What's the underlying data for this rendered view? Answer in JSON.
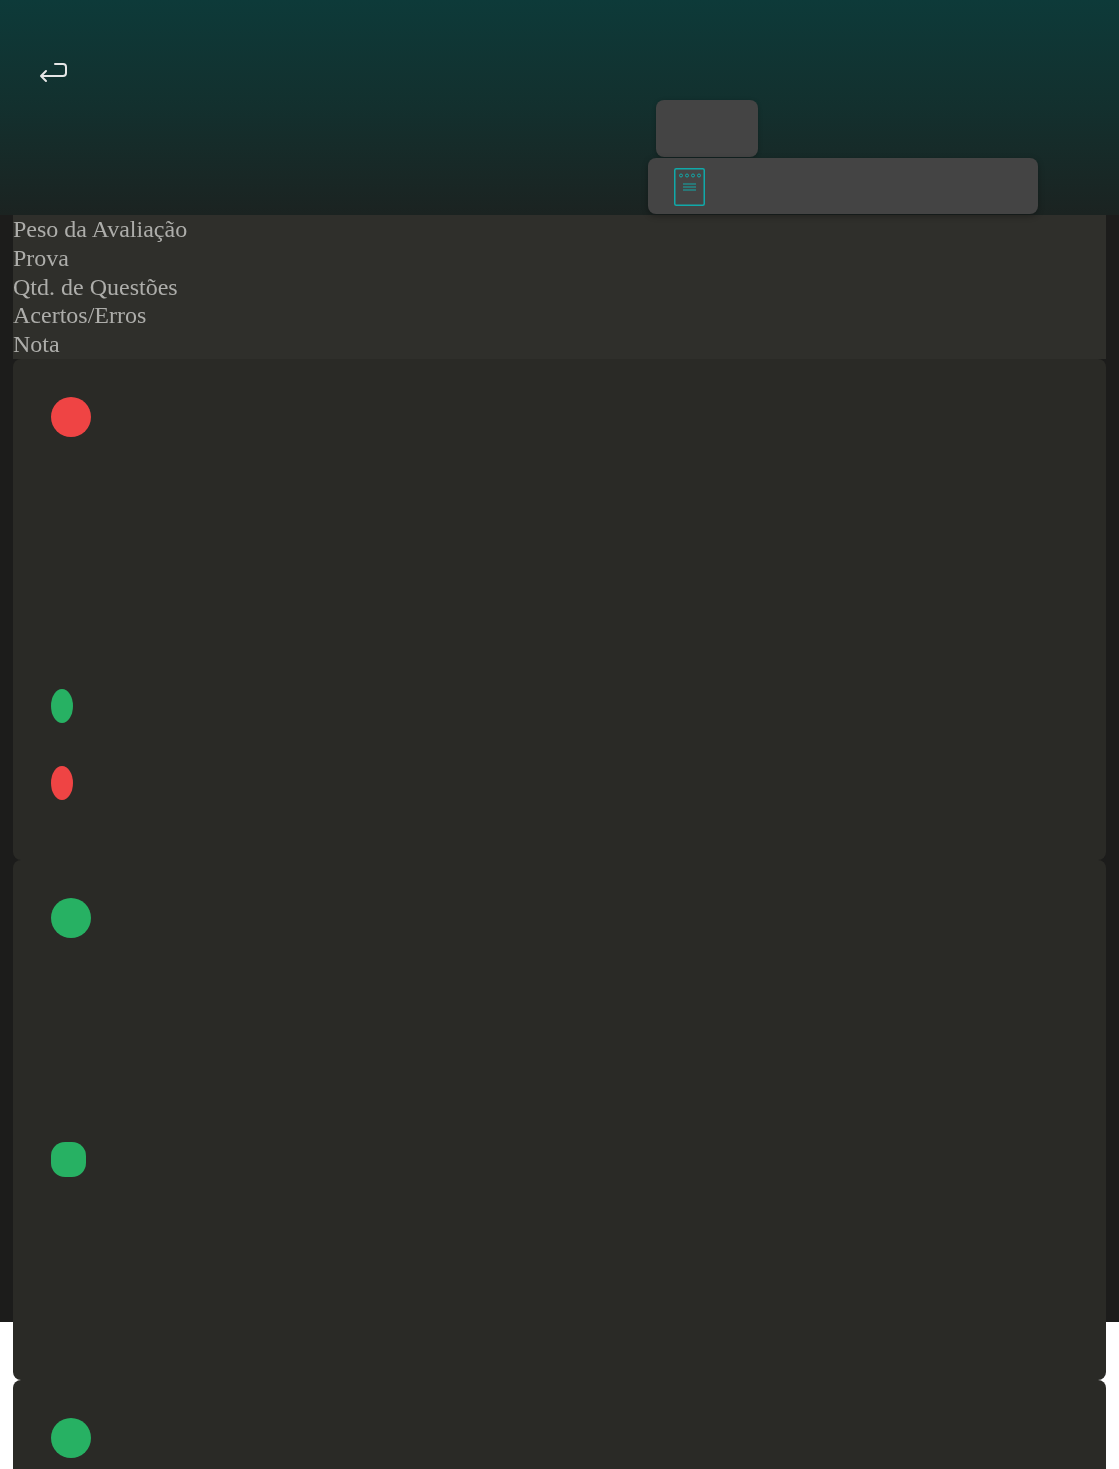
{
  "table": {
    "columns": [
      "Peso da Avaliação",
      "Prova",
      "Qtd. de Questões",
      "Acertos/Erros",
      "Nota"
    ]
  },
  "records": [
    {
      "markers": [
        {
          "kind": "dot",
          "color": "#ef4444"
        },
        {
          "kind": "pill",
          "color": "#27b163"
        },
        {
          "kind": "pill",
          "color": "#ef4444"
        }
      ]
    },
    {
      "markers": [
        {
          "kind": "dot",
          "color": "#27b163"
        },
        {
          "kind": "chip",
          "color": "#27b163"
        }
      ]
    },
    {
      "markers": [
        {
          "kind": "dot",
          "color": "#27b163"
        }
      ]
    }
  ]
}
